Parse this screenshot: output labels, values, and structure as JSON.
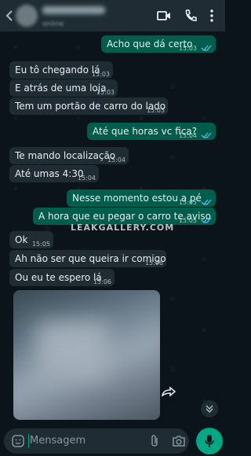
{
  "header": {
    "contact_status": "online",
    "icons": {
      "back": "back-arrow-icon",
      "video": "video-call-icon",
      "phone": "voice-call-icon",
      "menu": "more-options-icon"
    }
  },
  "messages": [
    {
      "dir": "out",
      "text": "Acho que dá certo",
      "time": "15:03",
      "status": "read"
    },
    {
      "dir": "in",
      "text": "Eu tô chegando lá",
      "time": "15:03"
    },
    {
      "dir": "in",
      "text": "E atrás de uma loja",
      "time": "15:03"
    },
    {
      "dir": "in",
      "text": "Tem um portão de carro do lado",
      "time": "15:03"
    },
    {
      "dir": "out",
      "text": "Até que horas vc fica?",
      "time": "15:04",
      "status": "read"
    },
    {
      "dir": "in",
      "text": "Te mando localização",
      "time": "15:04"
    },
    {
      "dir": "in",
      "text": "Até umas 4:30",
      "time": "15:04"
    },
    {
      "dir": "out",
      "text": "Nesse momento estou a pé",
      "time": "15:05",
      "status": "read"
    },
    {
      "dir": "out",
      "text": "A hora que eu pegar o carro te aviso",
      "time": "15:05",
      "status": "read"
    },
    {
      "dir": "in",
      "text": "Ok",
      "time": "15:05"
    },
    {
      "dir": "in",
      "text": "Ah não ser que queira ir comigo",
      "time": "15:06"
    },
    {
      "dir": "in",
      "text": "Ou eu te espero lá",
      "time": "15:06"
    }
  ],
  "watermark": "LEAKGALLERY.COM",
  "composer": {
    "placeholder": "Mensagem"
  },
  "colors": {
    "incoming": "#202c33",
    "outgoing": "#005c4b",
    "accent": "#00a884",
    "read_ticks": "#53bdeb"
  }
}
